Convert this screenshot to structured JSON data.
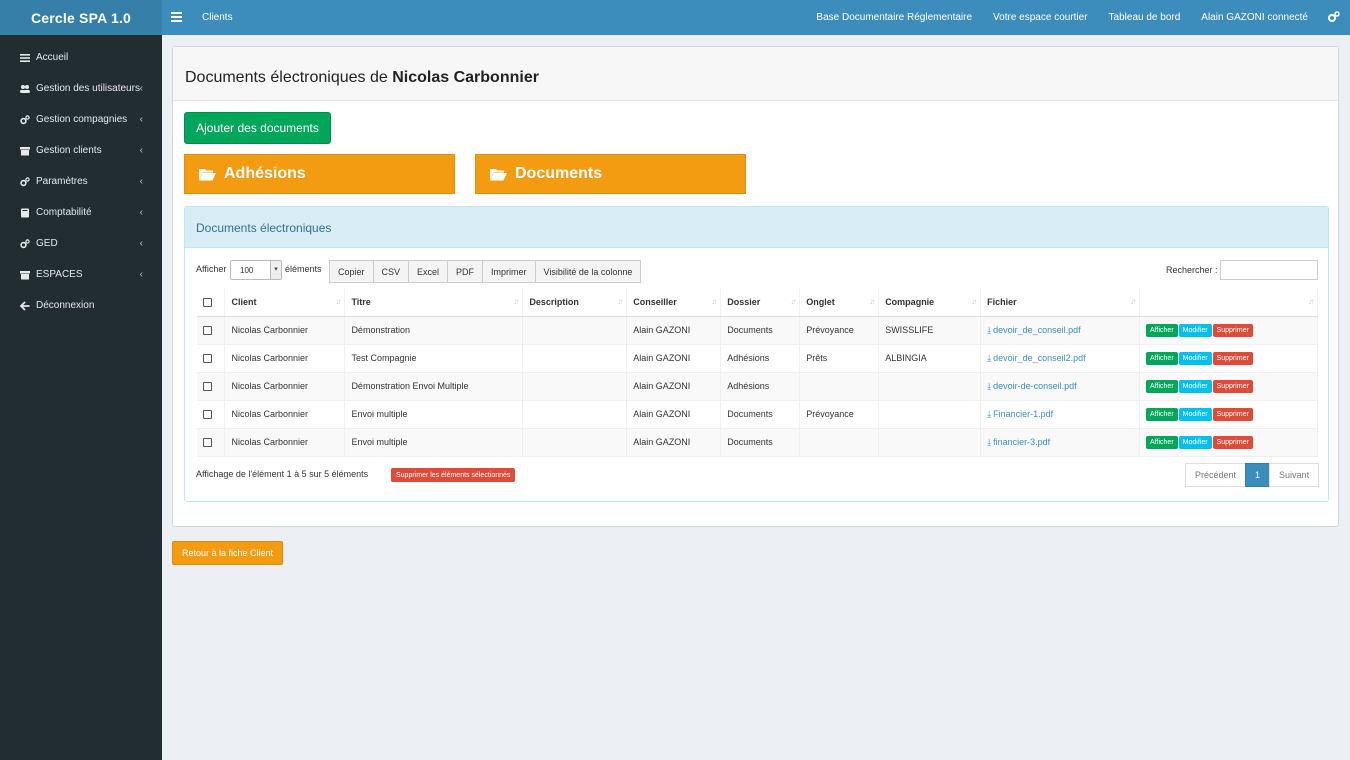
{
  "app": {
    "brand": "Cercle SPA 1.0"
  },
  "topbar": {
    "section": "Clients",
    "links": [
      "Base Documentaire Réglementaire",
      "Votre espace courtier",
      "Tableau de bord",
      "Alain GAZONI connecté"
    ],
    "settings_icon": "cogs-icon",
    "menu_icon": "bars-icon"
  },
  "sidebar": {
    "items": [
      {
        "label": "Accueil",
        "icon": "bars-icon",
        "has_submenu": false
      },
      {
        "label": "Gestion des utilisateurs",
        "icon": "users-icon",
        "has_submenu": true
      },
      {
        "label": "Gestion compagnies",
        "icon": "cogs-icon",
        "has_submenu": true
      },
      {
        "label": "Gestion clients",
        "icon": "archive-icon",
        "has_submenu": true
      },
      {
        "label": "Paramètres",
        "icon": "cogs-icon",
        "has_submenu": true
      },
      {
        "label": "Comptabilité",
        "icon": "book-icon",
        "has_submenu": true
      },
      {
        "label": "GED",
        "icon": "cogs-icon",
        "has_submenu": true
      },
      {
        "label": "ESPACES",
        "icon": "archive-icon",
        "has_submenu": true
      },
      {
        "label": "Déconnexion",
        "icon": "arrow-left-icon",
        "has_submenu": false
      }
    ]
  },
  "page": {
    "title_prefix": "Documents électroniques de ",
    "client_name": "Nicolas Carbonnier",
    "add_button": "Ajouter des documents",
    "folders": [
      "Adhésions",
      "Documents"
    ],
    "back_button": "Retour à la fiche Client"
  },
  "panel": {
    "title": "Documents électroniques",
    "length_label_before": "Afficher",
    "length_value": "100",
    "length_label_after": "éléments",
    "export_buttons": [
      "Copier",
      "CSV",
      "Excel",
      "PDF",
      "Imprimer",
      "Visibilité de la colonne"
    ],
    "search_label": "Rechercher :",
    "search_value": "",
    "info": "Affichage de l'élément 1 à 5 sur 5 éléments",
    "delete_selected": "Supprimer les éléments sélectionnés",
    "pagination": {
      "prev": "Précédent",
      "current": "1",
      "next": "Suivant"
    }
  },
  "table": {
    "columns": [
      "",
      "Client",
      "Titre",
      "Description",
      "Conseiller",
      "Dossier",
      "Onglet",
      "Compagnie",
      "Fichier",
      ""
    ],
    "actions": [
      "Afficher",
      "Modifier",
      "Supprimer"
    ],
    "rows": [
      {
        "client": "Nicolas Carbonnier",
        "titre": "Démonstration",
        "description": "",
        "conseiller": "Alain GAZONI",
        "dossier": "Documents",
        "onglet": "Prévoyance",
        "compagnie": "SWISSLIFE",
        "fichier": "devoir_de_conseil.pdf"
      },
      {
        "client": "Nicolas Carbonnier",
        "titre": "Test Compagnie",
        "description": "",
        "conseiller": "Alain GAZONI",
        "dossier": "Adhésions",
        "onglet": "Prêts",
        "compagnie": "ALBINGIA",
        "fichier": "devoir_de_conseil2.pdf"
      },
      {
        "client": "Nicolas Carbonnier",
        "titre": "Démonstration Envoi Multiple",
        "description": "",
        "conseiller": "Alain GAZONI",
        "dossier": "Adhésions",
        "onglet": "",
        "compagnie": "",
        "fichier": "devoir-de-conseil.pdf"
      },
      {
        "client": "Nicolas Carbonnier",
        "titre": "Envoi multiple",
        "description": "",
        "conseiller": "Alain GAZONI",
        "dossier": "Documents",
        "onglet": "Prévoyance",
        "compagnie": "",
        "fichier": "Financier-1.pdf"
      },
      {
        "client": "Nicolas Carbonnier",
        "titre": "Envoi multiple",
        "description": "",
        "conseiller": "Alain GAZONI",
        "dossier": "Documents",
        "onglet": "",
        "compagnie": "",
        "fichier": "financier-3.pdf"
      }
    ]
  },
  "colors": {
    "topbar": "#3c8dbc",
    "sidebar": "#222d32",
    "success": "#00a65a",
    "warning": "#f39c12",
    "danger": "#dd4b39",
    "info": "#00c0ef"
  }
}
